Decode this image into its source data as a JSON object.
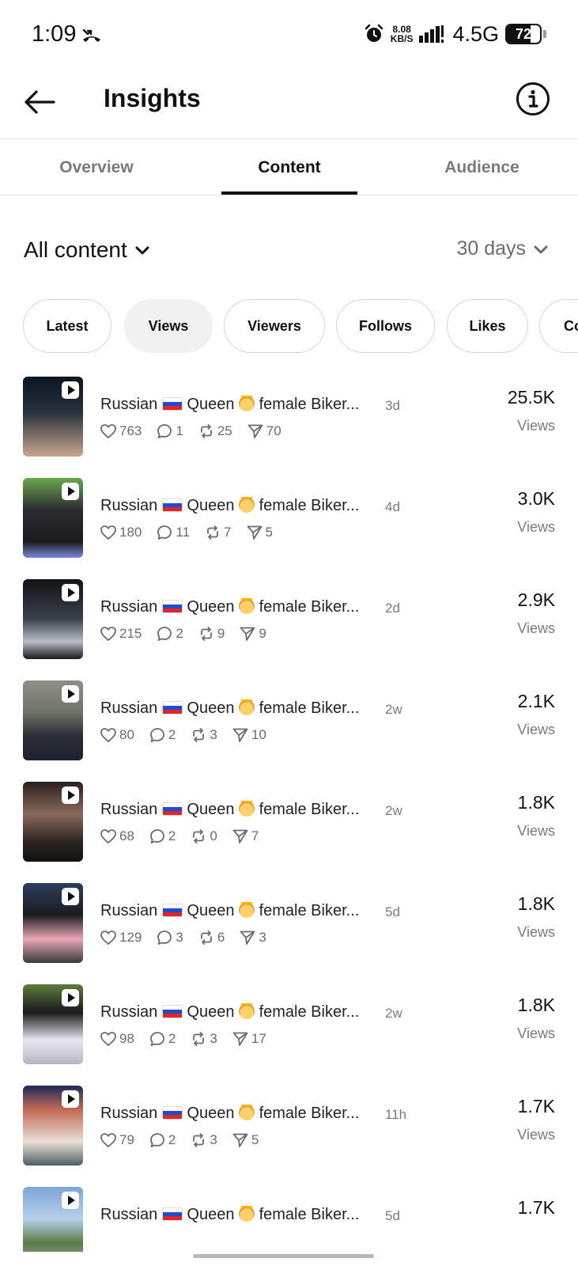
{
  "status_bar": {
    "time": "1:09",
    "speed_value": "8.08",
    "speed_unit": "KB/S",
    "network": "4.5G",
    "battery": "72",
    "battery_level": 0.72
  },
  "header": {
    "title": "Insights"
  },
  "tabs": [
    {
      "label": "Overview",
      "active": false
    },
    {
      "label": "Content",
      "active": true
    },
    {
      "label": "Audience",
      "active": false
    }
  ],
  "filters": {
    "content_type": "All content",
    "period": "30 days"
  },
  "sort_chips": [
    {
      "label": "Latest",
      "selected": false
    },
    {
      "label": "Views",
      "selected": true
    },
    {
      "label": "Viewers",
      "selected": false
    },
    {
      "label": "Follows",
      "selected": false
    },
    {
      "label": "Likes",
      "selected": false
    },
    {
      "label": "Co",
      "selected": false
    }
  ],
  "posts": [
    {
      "title_a": "Russian",
      "title_b": "Queen",
      "title_c": "female Biker...",
      "age": "3d",
      "likes": "763",
      "comments": "1",
      "reposts": "25",
      "shares": "70",
      "views": "25.5K",
      "views_label": "Views"
    },
    {
      "title_a": "Russian",
      "title_b": "Queen",
      "title_c": "female Biker...",
      "age": "4d",
      "likes": "180",
      "comments": "11",
      "reposts": "7",
      "shares": "5",
      "views": "3.0K",
      "views_label": "Views"
    },
    {
      "title_a": "Russian",
      "title_b": "Queen",
      "title_c": "female Biker...",
      "age": "2d",
      "likes": "215",
      "comments": "2",
      "reposts": "9",
      "shares": "9",
      "views": "2.9K",
      "views_label": "Views"
    },
    {
      "title_a": "Russian",
      "title_b": "Queen",
      "title_c": "female Biker...",
      "age": "2w",
      "likes": "80",
      "comments": "2",
      "reposts": "3",
      "shares": "10",
      "views": "2.1K",
      "views_label": "Views"
    },
    {
      "title_a": "Russian",
      "title_b": "Queen",
      "title_c": "female Biker...",
      "age": "2w",
      "likes": "68",
      "comments": "2",
      "reposts": "0",
      "shares": "7",
      "views": "1.8K",
      "views_label": "Views"
    },
    {
      "title_a": "Russian",
      "title_b": "Queen",
      "title_c": "female Biker...",
      "age": "5d",
      "likes": "129",
      "comments": "3",
      "reposts": "6",
      "shares": "3",
      "views": "1.8K",
      "views_label": "Views"
    },
    {
      "title_a": "Russian",
      "title_b": "Queen",
      "title_c": "female Biker...",
      "age": "2w",
      "likes": "98",
      "comments": "2",
      "reposts": "3",
      "shares": "17",
      "views": "1.8K",
      "views_label": "Views"
    },
    {
      "title_a": "Russian",
      "title_b": "Queen",
      "title_c": "female Biker...",
      "age": "11h",
      "likes": "79",
      "comments": "2",
      "reposts": "3",
      "shares": "5",
      "views": "1.7K",
      "views_label": "Views"
    },
    {
      "title_a": "Russian",
      "title_b": "Queen",
      "title_c": "female Biker...",
      "age": "5d",
      "likes": "",
      "comments": "",
      "reposts": "",
      "shares": "",
      "views": "1.7K",
      "views_label": ""
    }
  ],
  "colors": {
    "accent": "#111111",
    "muted_text": "#7a7a7a",
    "chip_selected_bg": "#f1f1f2",
    "divider": "#e4e4e4"
  }
}
